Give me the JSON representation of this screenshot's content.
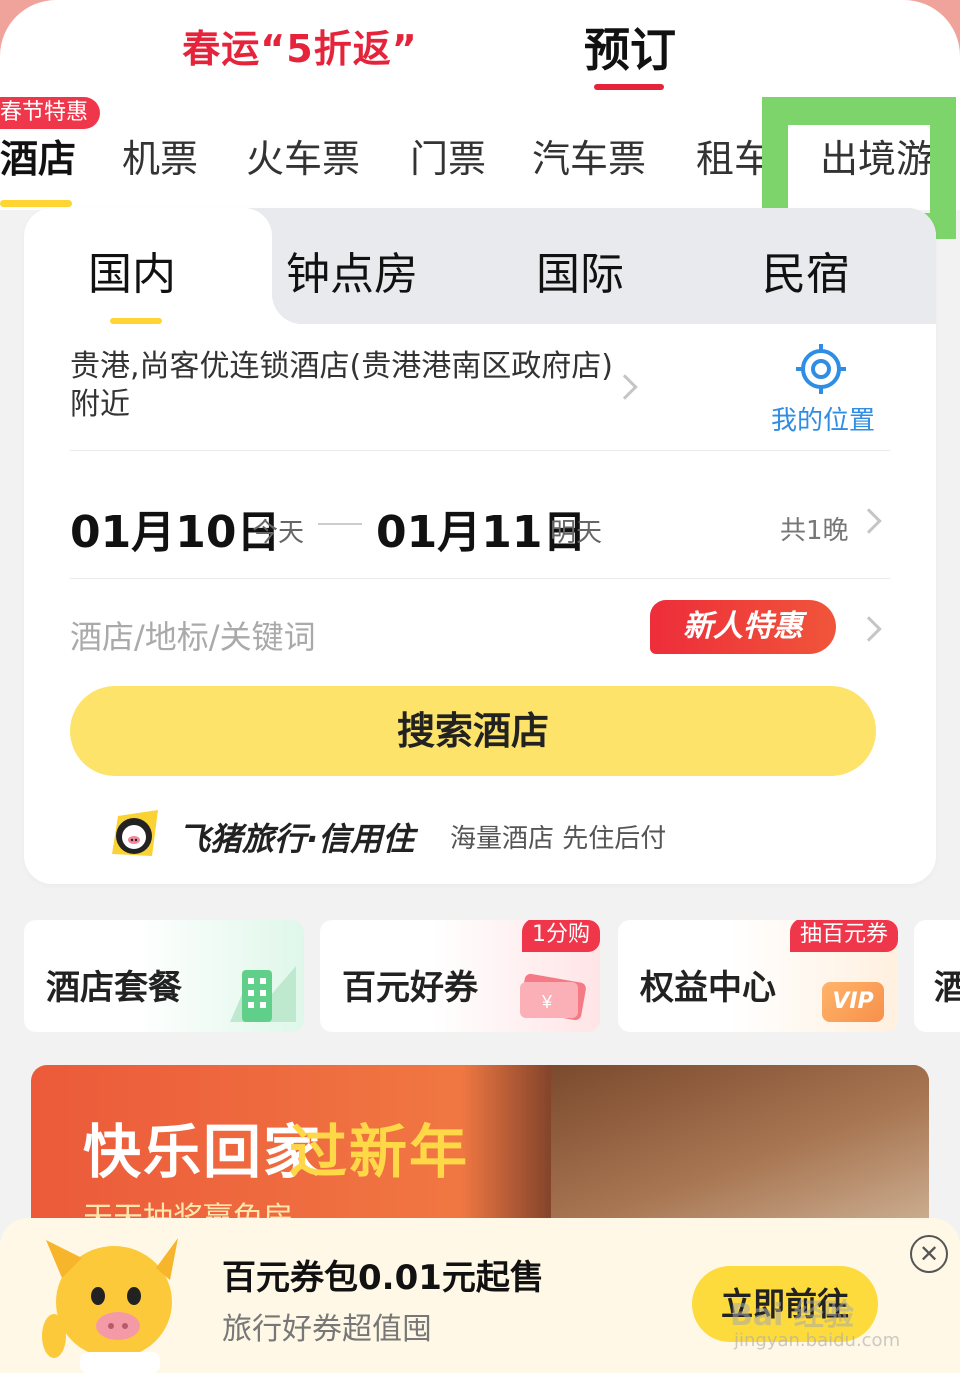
{
  "header": {
    "promo_title": "春运“5折返”",
    "book_title": "预订"
  },
  "categories": {
    "badge": "春节特惠",
    "items": [
      {
        "label": "酒店"
      },
      {
        "label": "机票"
      },
      {
        "label": "火车票"
      },
      {
        "label": "门票"
      },
      {
        "label": "汽车票"
      },
      {
        "label": "租车"
      },
      {
        "label": "出境游"
      }
    ]
  },
  "hotel_search": {
    "tabs": [
      {
        "label": "国内"
      },
      {
        "label": "钟点房"
      },
      {
        "label": "国际"
      },
      {
        "label": "民宿"
      }
    ],
    "location": "贵港,尚客优连锁酒店(贵港港南区政府店)附近",
    "my_location_label": "我的位置",
    "checkin_date": "01月10日",
    "checkin_day": "今天",
    "checkout_date": "01月11日",
    "checkout_day": "明天",
    "nights": "共1晚",
    "keyword_placeholder": "酒店/地标/关键词",
    "newbie_badge": "新人特惠",
    "search_button": "搜索酒店",
    "brand_name": "飞猪旅行·信用住",
    "brand_slogan": "海量酒店  先住后付"
  },
  "features": [
    {
      "label": "酒店套餐",
      "tag": ""
    },
    {
      "label": "百元好券",
      "tag": "1分购"
    },
    {
      "label": "权益中心",
      "tag": "抽百元券",
      "icon_text": "VIP"
    },
    {
      "label": "酒",
      "tag": ""
    }
  ],
  "banner": {
    "title_white": "快乐回家",
    "title_yellow": "过新年",
    "subtitle": "天天抽奖赢免房"
  },
  "popup": {
    "title": "百元券包0.01元起售",
    "subtitle": "旅行好券超值囤",
    "button": "立即前往",
    "close_symbol": "✕"
  },
  "watermark": {
    "main": "Bai 经验",
    "sub": "jingyan.baidu.com"
  },
  "colors": {
    "accent_red": "#e5243b",
    "accent_yellow": "#fde36a",
    "link_blue": "#2f8de4",
    "highlight_green": "#7dd46b"
  }
}
